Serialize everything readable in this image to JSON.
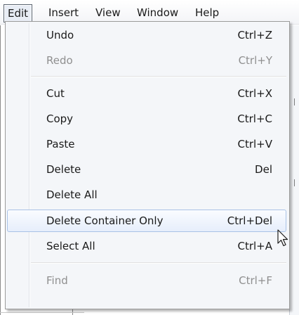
{
  "menubar": {
    "items": [
      {
        "label": "Edit",
        "active": true
      },
      {
        "label": "Insert"
      },
      {
        "label": "View"
      },
      {
        "label": "Window"
      },
      {
        "label": "Help"
      }
    ]
  },
  "edit_menu": {
    "items": [
      {
        "label": "Undo",
        "shortcut": "Ctrl+Z",
        "enabled": true
      },
      {
        "label": "Redo",
        "shortcut": "Ctrl+Y",
        "enabled": false
      },
      {
        "label": "Cut",
        "shortcut": "Ctrl+X",
        "enabled": true
      },
      {
        "label": "Copy",
        "shortcut": "Ctrl+C",
        "enabled": true
      },
      {
        "label": "Paste",
        "shortcut": "Ctrl+V",
        "enabled": true
      },
      {
        "label": "Delete",
        "shortcut": "Del",
        "enabled": true
      },
      {
        "label": "Delete All",
        "shortcut": "",
        "enabled": true
      },
      {
        "label": "Delete Container Only",
        "shortcut": "Ctrl+Del",
        "enabled": true,
        "highlighted": true
      },
      {
        "label": "Select All",
        "shortcut": "Ctrl+A",
        "enabled": true
      },
      {
        "label": "Find",
        "shortcut": "Ctrl+F",
        "enabled": false
      }
    ]
  },
  "colors": {
    "menu_background": "#f4f6f9",
    "disabled_text": "#8f8f8f",
    "highlight_border": "#a9c2e6"
  }
}
